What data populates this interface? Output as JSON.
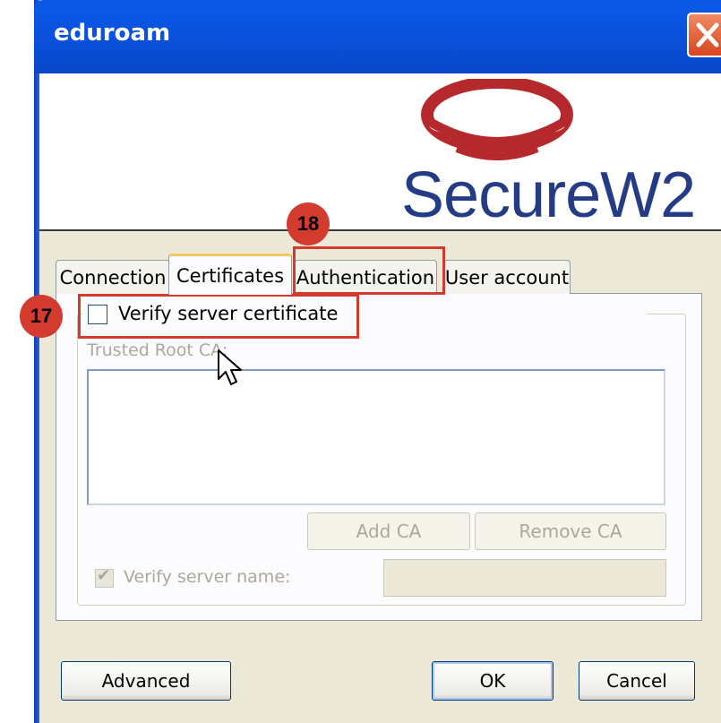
{
  "window": {
    "title": "eduroam"
  },
  "banner": {
    "logo_text": "SecureW2",
    "logo_color": "#243c86",
    "ring_color": "#b5282b"
  },
  "tabs": [
    {
      "label": "Connection"
    },
    {
      "label": "Certificates",
      "selected": true
    },
    {
      "label": "Authentication"
    },
    {
      "label": "User account"
    }
  ],
  "certificates": {
    "verify_cert_label": "Verify server certificate",
    "verify_cert_checked": false,
    "trusted_root_label": "Trusted Root CA:",
    "add_ca_label": "Add CA",
    "remove_ca_label": "Remove CA",
    "verify_name_label": "Verify server name:",
    "verify_name_checked": true,
    "server_name_value": ""
  },
  "footer": {
    "advanced_label": "Advanced",
    "ok_label": "OK",
    "cancel_label": "Cancel"
  },
  "annotations": {
    "marker_17": "17",
    "marker_18": "18",
    "color": "#d23b2e"
  }
}
